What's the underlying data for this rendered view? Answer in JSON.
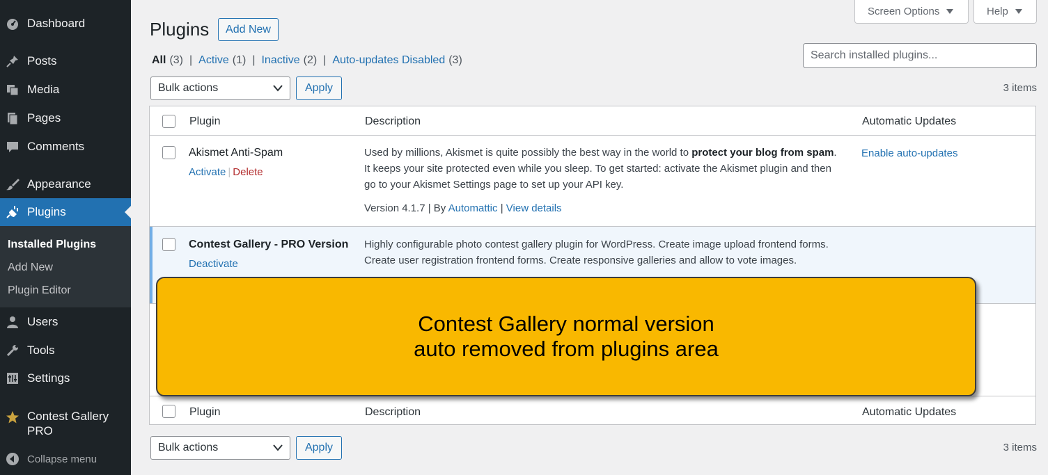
{
  "sidebar": {
    "items": [
      {
        "label": "Dashboard",
        "icon": "dashboard-icon"
      },
      {
        "label": "Posts",
        "icon": "pushpin-icon"
      },
      {
        "label": "Media",
        "icon": "media-icon"
      },
      {
        "label": "Pages",
        "icon": "pages-icon"
      },
      {
        "label": "Comments",
        "icon": "comment-icon"
      },
      {
        "label": "Appearance",
        "icon": "paintbrush-icon"
      },
      {
        "label": "Plugins",
        "icon": "plug-icon"
      },
      {
        "label": "Users",
        "icon": "user-icon"
      },
      {
        "label": "Tools",
        "icon": "wrench-icon"
      },
      {
        "label": "Settings",
        "icon": "settings-icon"
      },
      {
        "label": "Contest Gallery PRO",
        "icon": "star-icon"
      }
    ],
    "submenu": [
      "Installed Plugins",
      "Add New",
      "Plugin Editor"
    ],
    "collapse_label": "Collapse menu"
  },
  "top": {
    "screen_options": "Screen Options",
    "help": "Help"
  },
  "page": {
    "title": "Plugins",
    "add_new": "Add New"
  },
  "filters": {
    "all": "All",
    "all_count": "(3)",
    "active": "Active",
    "active_count": "(1)",
    "inactive": "Inactive",
    "inactive_count": "(2)",
    "auto_updates_disabled": "Auto-updates Disabled",
    "auto_updates_disabled_count": "(3)",
    "separator": "|"
  },
  "search": {
    "placeholder": "Search installed plugins..."
  },
  "bulk": {
    "label": "Bulk actions",
    "apply": "Apply",
    "items_count": "3 items"
  },
  "table": {
    "headers": {
      "plugin": "Plugin",
      "description": "Description",
      "auto_updates": "Automatic Updates"
    },
    "rows": [
      {
        "name": "Akismet Anti-Spam",
        "action1": "Activate",
        "action2": "Delete",
        "desc_pre": "Used by millions, Akismet is quite possibly the best way in the world to ",
        "desc_bold": "protect your blog from spam",
        "desc_post": ". It keeps your site protected even while you sleep. To get started: activate the Akismet plugin and then go to your Akismet Settings page to set up your API key.",
        "version": "Version 4.1.7",
        "by": "| By",
        "author": "Automattic",
        "sep": "|",
        "details": "View details",
        "auto_update": "Enable auto-updates"
      },
      {
        "name": "Contest Gallery - PRO Version",
        "action1": "Deactivate",
        "desc": "Highly configurable photo contest gallery plugin for WordPress. Create image upload frontend forms. Create user registration frontend forms. Create responsive galleries and allow to vote images."
      }
    ]
  },
  "callout": {
    "line1": "Contest Gallery normal version",
    "line2": "auto removed from plugins area"
  },
  "colors": {
    "sidebar": "#1d2327",
    "accent": "#2271b1",
    "callout": "#f9b800",
    "delete": "#b32d2e"
  }
}
